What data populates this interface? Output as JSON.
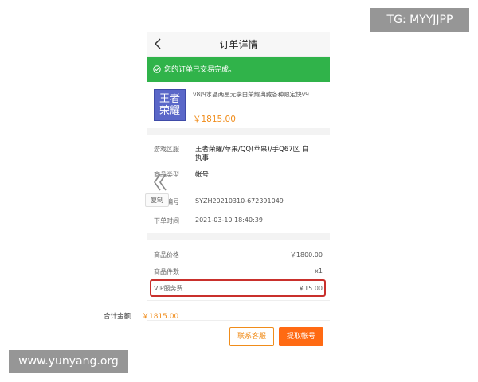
{
  "header": {
    "title": "订单详情"
  },
  "status_banner": {
    "text": "您的订单已交易完成。",
    "color": "#30b34a"
  },
  "product": {
    "logo_line1": "王者",
    "logo_line2": "荣耀",
    "name": "v8四水晶两星元李白荣耀典藏各种限定快v9",
    "price": "￥1815.00"
  },
  "info": {
    "region_label": "游戏区服",
    "region_value_line1": "王者荣耀/苹果/QQ(苹果)/手Q67区 白",
    "region_value_line2": "执事",
    "type_label": "商品类型",
    "type_value": "帐号",
    "order_no_label": "订单编号",
    "order_no_value": "SYZH20210310-672391049",
    "copy_label": "复制",
    "time_label": "下单时间",
    "time_value": "2021-03-10 18:40:39"
  },
  "fees": [
    {
      "label": "商品价格",
      "value": "￥1800.00"
    },
    {
      "label": "商品件数",
      "value": "x1"
    },
    {
      "label": "VIP服务费",
      "value": "￥15.00"
    }
  ],
  "total": {
    "label": "合计金额",
    "value": "￥1815.00"
  },
  "actions": {
    "service_label": "联系客服",
    "fetch_label": "提取帐号"
  },
  "watermarks": {
    "tg": "TG: MYYJJPP",
    "site": "www.yunyang.org"
  },
  "colors": {
    "accent": "#f08c1a",
    "button_fill": "#ff6a13",
    "highlight": "#c9302c"
  }
}
